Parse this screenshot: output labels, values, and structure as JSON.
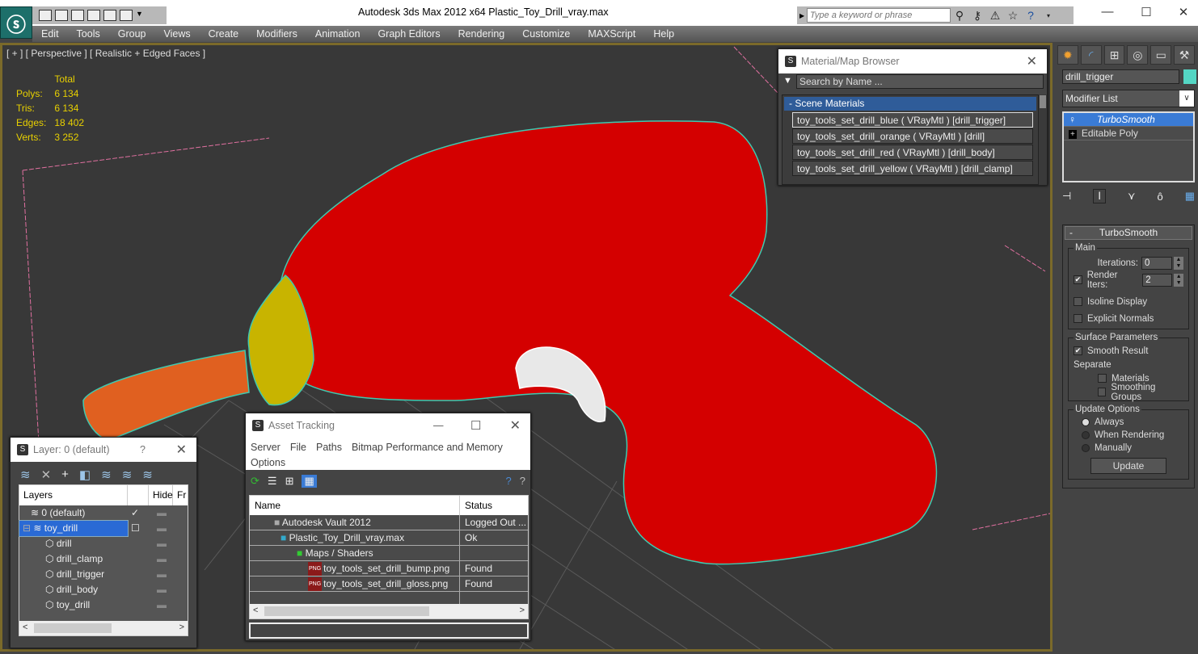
{
  "window": {
    "title": "Autodesk 3ds Max  2012 x64      Plastic_Toy_Drill_vray.max",
    "search_placeholder": "Type a keyword or phrase"
  },
  "menu": [
    "Edit",
    "Tools",
    "Group",
    "Views",
    "Create",
    "Modifiers",
    "Animation",
    "Graph Editors",
    "Rendering",
    "Customize",
    "MAXScript",
    "Help"
  ],
  "viewport": {
    "label": "[ + ] [ Perspective ] [ Realistic + Edged Faces ]",
    "stats": {
      "header": "Total",
      "rows": [
        {
          "label": "Polys:",
          "value": "6 134"
        },
        {
          "label": "Tris:",
          "value": "6 134"
        },
        {
          "label": "Edges:",
          "value": "18 402"
        },
        {
          "label": "Verts:",
          "value": "3 252"
        }
      ]
    }
  },
  "material_browser": {
    "title": "Material/Map Browser",
    "search_placeholder": "Search by Name ...",
    "group": "- Scene Materials",
    "items": [
      "toy_tools_set_drill_blue ( VRayMtl ) [drill_trigger]",
      "toy_tools_set_drill_orange ( VRayMtl ) [drill]",
      "toy_tools_set_drill_red ( VRayMtl ) [drill_body]",
      "toy_tools_set_drill_yellow ( VRayMtl ) [drill_clamp]"
    ]
  },
  "command_panel": {
    "object_name": "drill_trigger",
    "object_color": "#54d6c4",
    "modifier_list": "Modifier List",
    "stack": [
      "TurboSmooth",
      "Editable Poly"
    ],
    "rollout": {
      "title": "TurboSmooth",
      "main_label": "Main",
      "iterations_label": "Iterations:",
      "iterations": "0",
      "render_iters_label": "Render Iters:",
      "render_iters": "2",
      "render_iters_checked": true,
      "isoline": "Isoline Display",
      "explicit_normals": "Explicit Normals",
      "surface_label": "Surface Parameters",
      "smooth_result": "Smooth Result",
      "separate": "Separate",
      "materials": "Materials",
      "smoothing_groups": "Smoothing Groups",
      "update_label": "Update Options",
      "always": "Always",
      "when_rendering": "When Rendering",
      "manually": "Manually",
      "update_button": "Update"
    }
  },
  "layer_dialog": {
    "title": "Layer: 0 (default)",
    "help": "?",
    "columns": [
      "Layers",
      "Hide",
      "Fr"
    ],
    "rows": [
      {
        "name": "0 (default)",
        "indent": 1
      },
      {
        "name": "toy_drill",
        "indent": 0,
        "selected": true
      },
      {
        "name": "drill",
        "indent": 2
      },
      {
        "name": "drill_clamp",
        "indent": 2
      },
      {
        "name": "drill_trigger",
        "indent": 2
      },
      {
        "name": "drill_body",
        "indent": 2
      },
      {
        "name": "toy_drill",
        "indent": 2
      }
    ]
  },
  "asset_tracking": {
    "title": "Asset Tracking",
    "menu": [
      "Server",
      "File",
      "Paths",
      "Bitmap Performance and Memory",
      "Options"
    ],
    "columns": [
      "Name",
      "Status"
    ],
    "rows": [
      {
        "name": "Autodesk Vault 2012",
        "status": "Logged Out ..."
      },
      {
        "name": "Plastic_Toy_Drill_vray.max",
        "status": "Ok"
      },
      {
        "name": "Maps / Shaders",
        "status": ""
      },
      {
        "name": "toy_tools_set_drill_bump.png",
        "status": "Found"
      },
      {
        "name": "toy_tools_set_drill_gloss.png",
        "status": "Found"
      }
    ]
  }
}
